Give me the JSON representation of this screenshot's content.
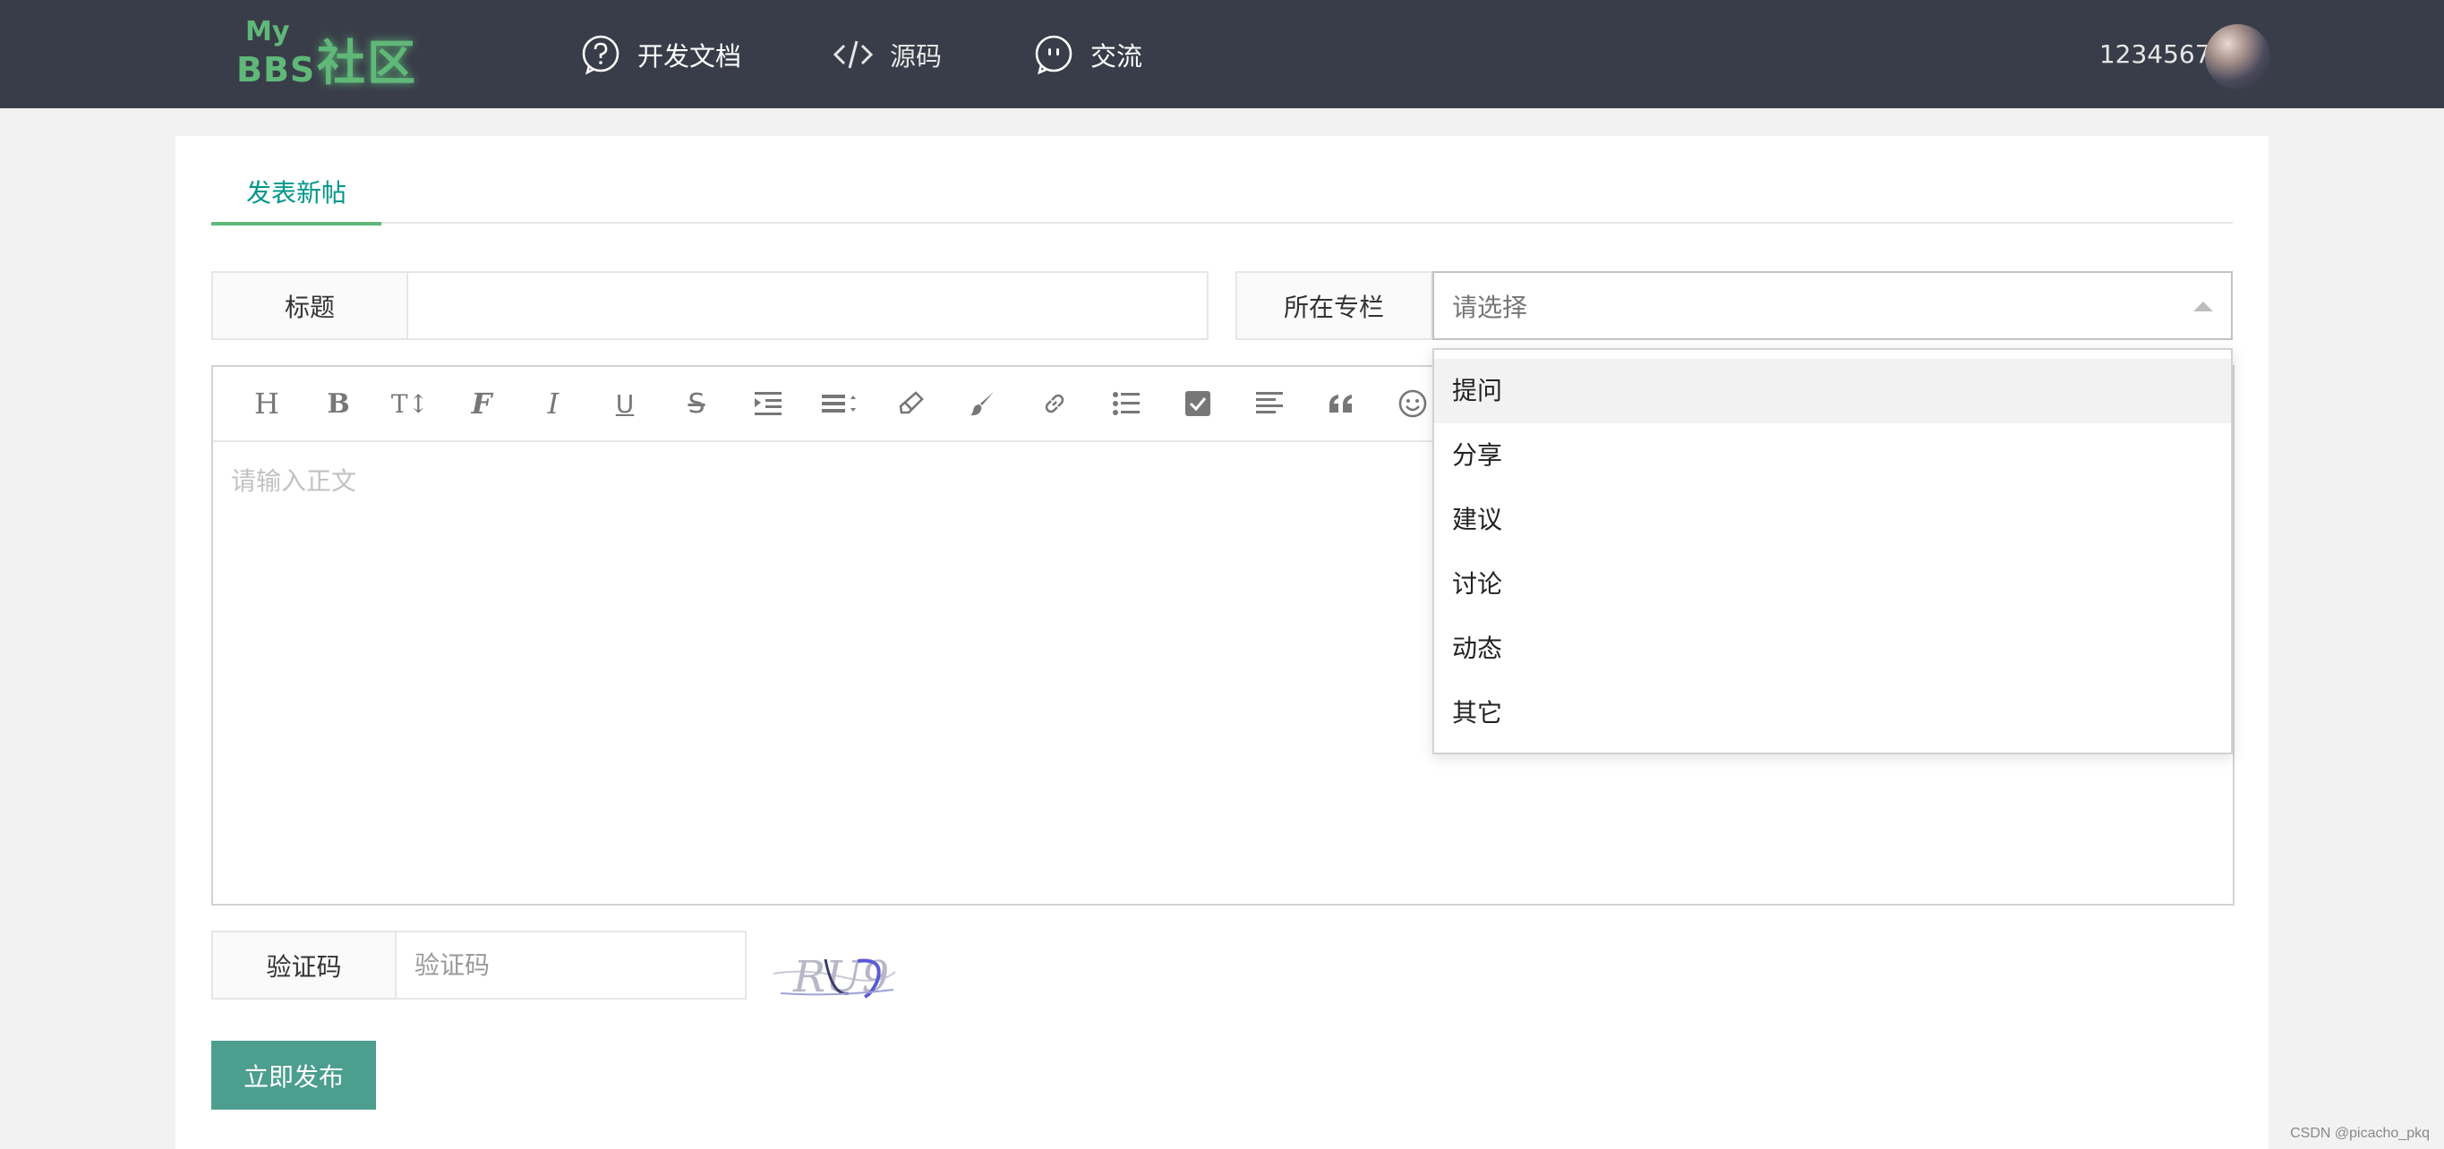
{
  "header": {
    "logo_my": "My",
    "logo_bbs": "BBS",
    "logo_cn": "社区",
    "nav": [
      {
        "label": "开发文档",
        "icon": "question-bubble-icon"
      },
      {
        "label": "源码",
        "icon": "code-icon"
      },
      {
        "label": "交流",
        "icon": "chat-bubble-icon"
      }
    ],
    "username": "1234567",
    "gender_symbol": "♂"
  },
  "tabs": [
    {
      "label": "发表新帖",
      "active": true
    }
  ],
  "form": {
    "title_label": "标题",
    "title_value": "",
    "column_label": "所在专栏",
    "column_placeholder": "请选择",
    "column_options": [
      "提问",
      "分享",
      "建议",
      "讨论",
      "动态",
      "其它"
    ],
    "content_placeholder": "请输入正文",
    "captcha_label": "验证码",
    "captcha_placeholder": "验证码",
    "captcha_image_text": "RU9",
    "submit_label": "立即发布"
  },
  "toolbar_icons": [
    "heading-icon",
    "bold-icon",
    "font-size-icon",
    "font-family-icon",
    "italic-icon",
    "underline-icon",
    "strikethrough-icon",
    "indent-icon",
    "line-height-icon",
    "eraser-icon",
    "brush-icon",
    "link-icon",
    "list-icon",
    "checkbox-icon",
    "align-icon",
    "quote-icon",
    "emoji-icon"
  ],
  "toolbar_glyphs": {
    "heading": "H",
    "bold": "B",
    "font_size": "T↕",
    "font_family": "F",
    "italic": "I",
    "underline": "U",
    "strike": "S"
  },
  "watermark": "CSDN @picacho_pkq",
  "colors": {
    "header_bg": "#393d49",
    "accent": "#5fb878",
    "button": "#4c9e8f"
  }
}
